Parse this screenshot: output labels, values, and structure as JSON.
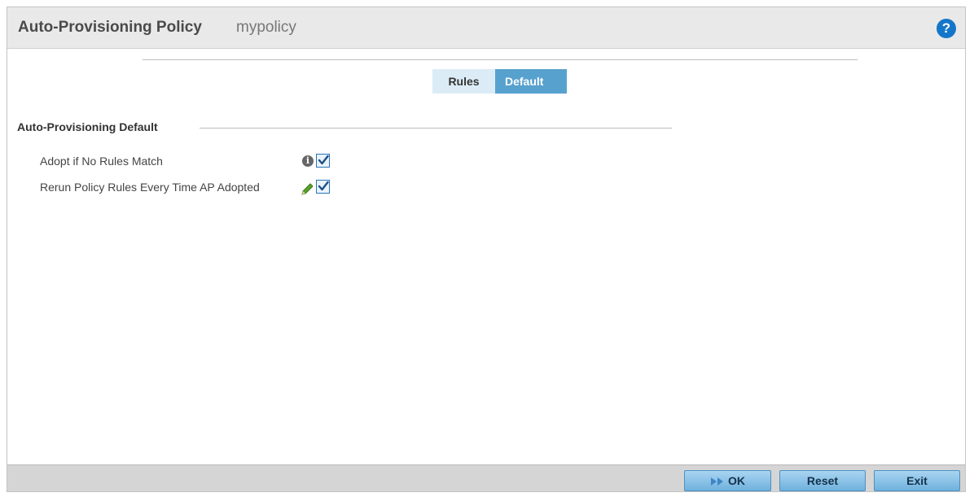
{
  "window": {
    "title": "Auto-Provisioning Policy",
    "subtitle": "mypolicy",
    "help_icon": "?"
  },
  "tabs": [
    {
      "label": "Rules",
      "active": false
    },
    {
      "label": "Default",
      "active": true
    }
  ],
  "section": {
    "title": "Auto-Provisioning Default",
    "fields": [
      {
        "label": "Adopt if No Rules Match",
        "icon": "info-icon",
        "checked": true
      },
      {
        "label": "Rerun Policy Rules Every Time AP Adopted",
        "icon": "pencil-icon",
        "checked": true
      }
    ]
  },
  "footer": {
    "ok_label": "OK",
    "reset_label": "Reset",
    "exit_label": "Exit"
  },
  "colors": {
    "active_tab": "#57a1cf",
    "inactive_tab": "#dcecf6",
    "help_icon": "#1576c9",
    "pencil": "#5aa02c"
  },
  "info_glyph": "i"
}
